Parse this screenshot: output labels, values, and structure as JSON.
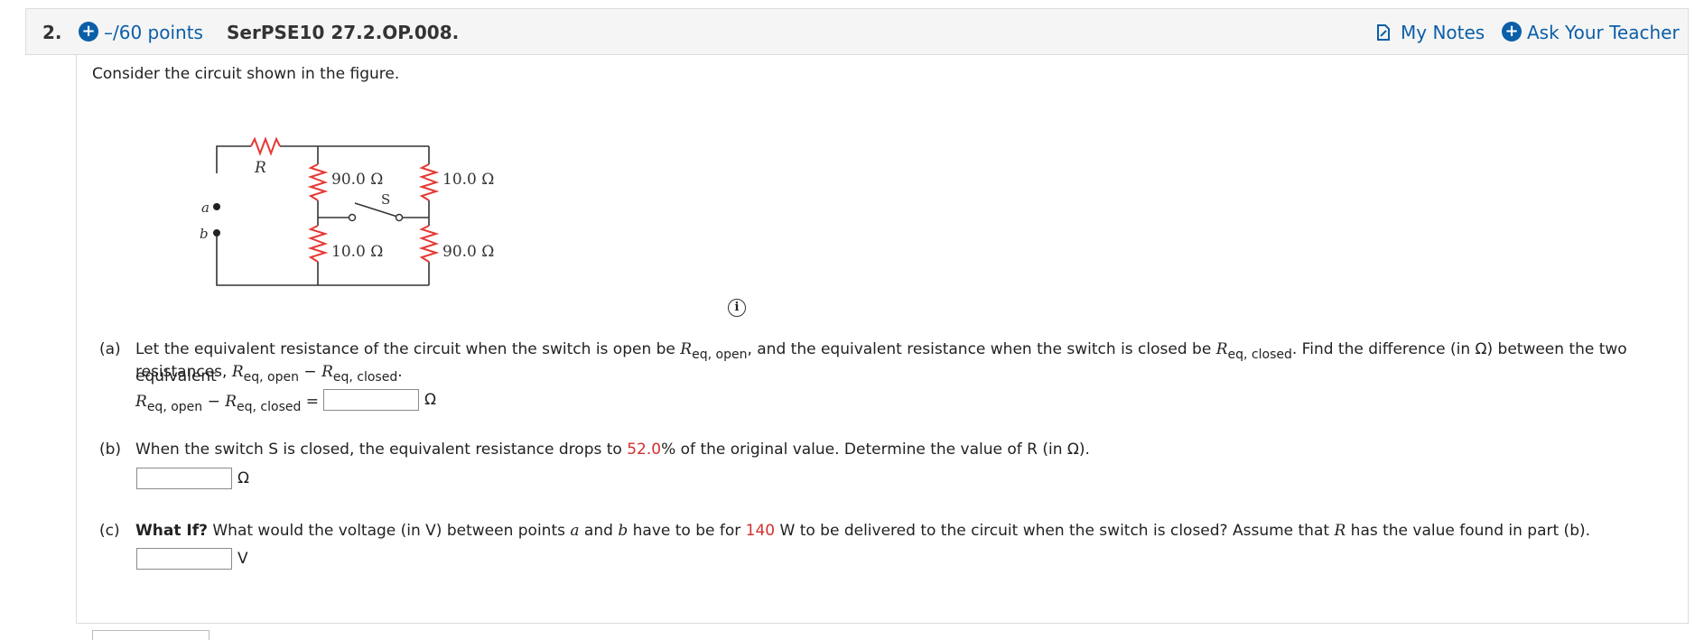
{
  "header": {
    "question_number": "2.",
    "points": "–/60 points",
    "question_id": "SerPSE10 27.2.OP.008.",
    "my_notes": "My Notes",
    "ask_teacher": "Ask Your Teacher"
  },
  "intro": "Consider the circuit shown in the figure.",
  "figure": {
    "r_label": "R",
    "a_label": "a",
    "b_label": "b",
    "s_label": "S",
    "r_top_middle": "90.0 Ω",
    "r_top_right": "10.0 Ω",
    "r_bottom_middle": "10.0 Ω",
    "r_bottom_right": "90.0 Ω"
  },
  "part_a": {
    "label": "(a)",
    "line1_pre": "Let the equivalent resistance of the circuit when the switch is open be ",
    "line1_mid": ", and the equivalent resistance when the switch is closed be ",
    "line1_post": ". Find the difference (in Ω) between the two equivalent",
    "line2_pre": "resistances, ",
    "line2_post": ".",
    "R": "R",
    "sub_open": "eq, open",
    "sub_closed": "eq, closed",
    "minus": "−",
    "equals": "=",
    "unit": "Ω"
  },
  "part_b": {
    "label": "(b)",
    "pre": "When the switch S is closed, the equivalent resistance drops to ",
    "value": "52.0",
    "post": "% of the original value. Determine the value of R (in Ω).",
    "unit": "Ω"
  },
  "part_c": {
    "label": "(c)",
    "bold": "What If?",
    "pre": " What would the voltage (in V) between points ",
    "a": "a",
    "and": " and ",
    "b": "b",
    "mid": " have to be for ",
    "value": "140",
    "post1": " W to be delivered to the circuit when the switch is closed? Assume that ",
    "R": "R",
    "post2": " has the value found in part (b).",
    "unit": "V"
  },
  "colors": {
    "accent": "#0b5ea8",
    "highlight": "#d32f2f",
    "resistor": "#e53935"
  }
}
